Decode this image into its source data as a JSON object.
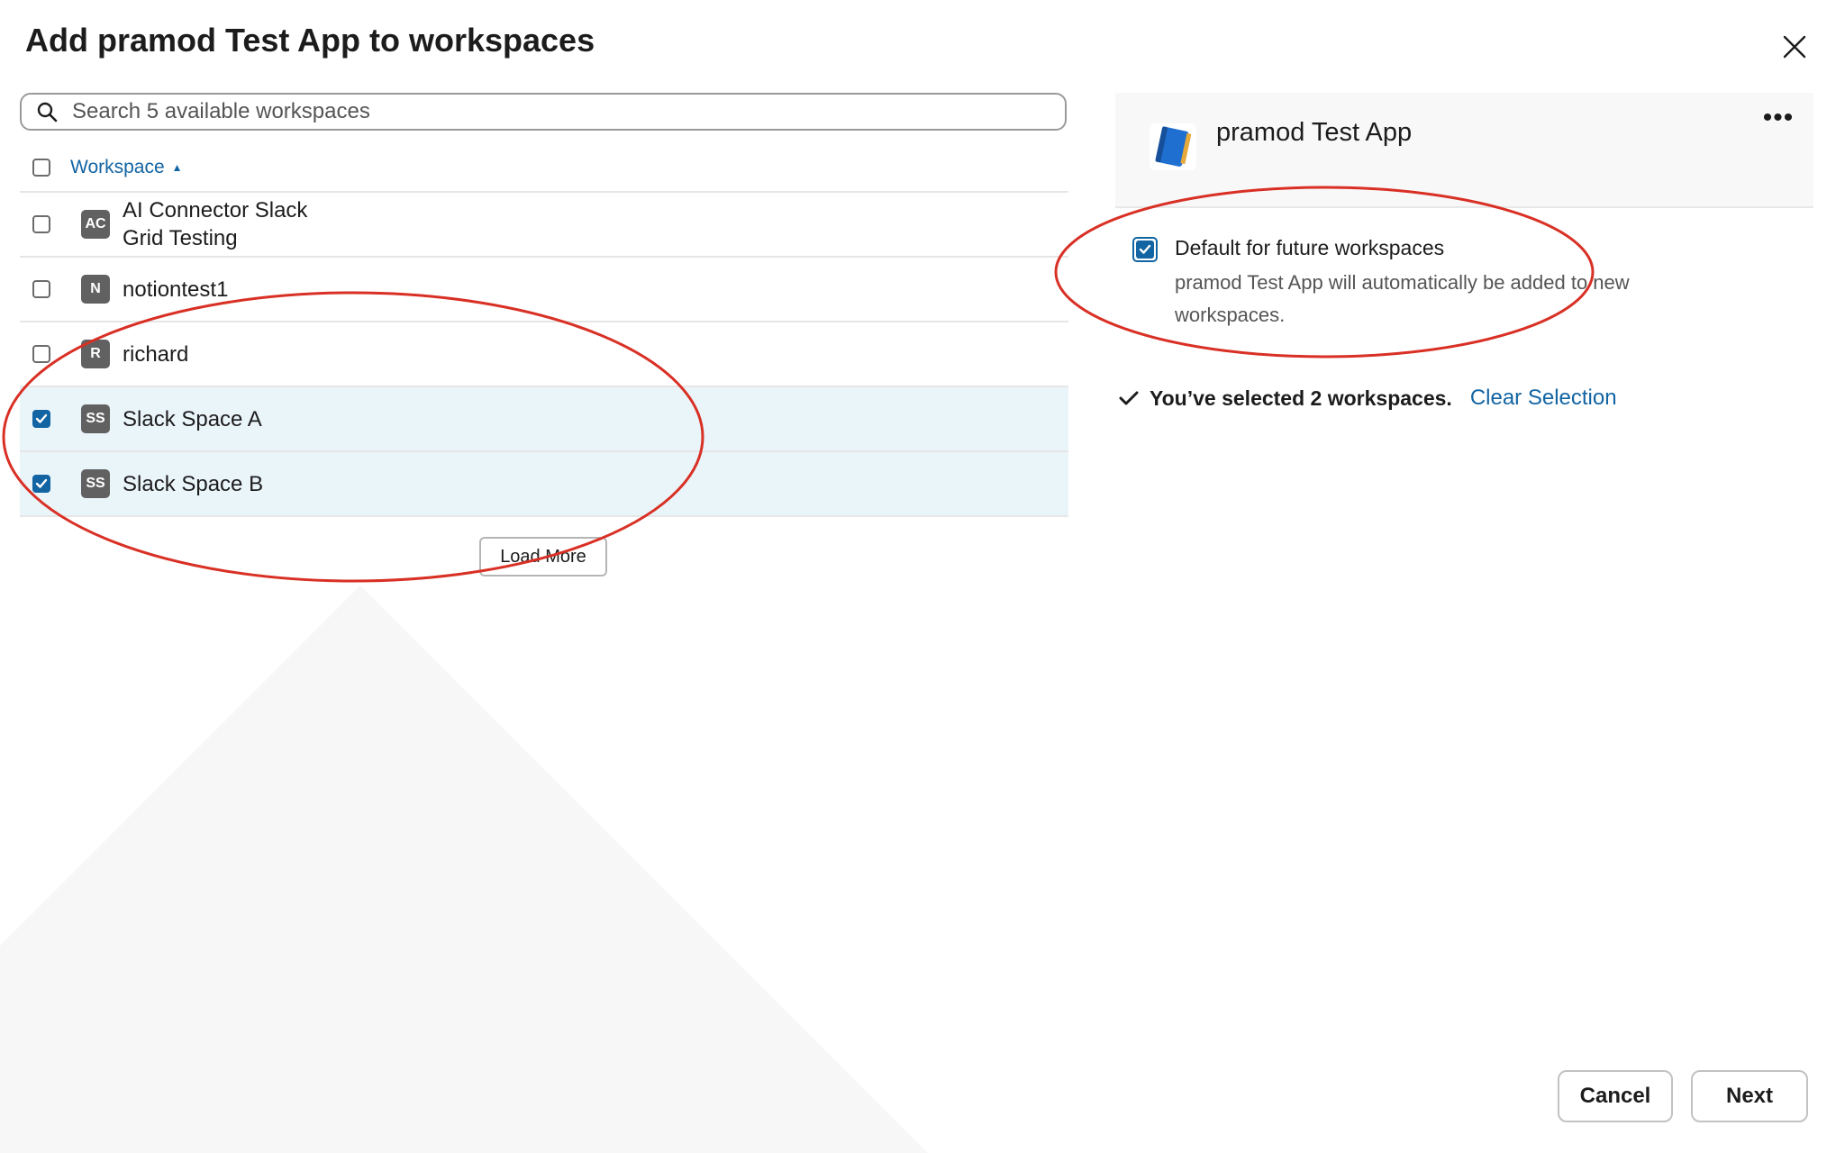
{
  "dialog": {
    "title": "Add pramod Test App to workspaces"
  },
  "search": {
    "placeholder": "Search 5 available workspaces"
  },
  "table": {
    "header_label": "Workspace",
    "rows": [
      {
        "initials": "AC",
        "name": "AI Connector Slack Grid Testing",
        "checked": false
      },
      {
        "initials": "N",
        "name": "notiontest1",
        "checked": false
      },
      {
        "initials": "R",
        "name": "richard",
        "checked": false
      },
      {
        "initials": "SS",
        "name": "Slack Space A",
        "checked": true
      },
      {
        "initials": "SS",
        "name": "Slack Space B",
        "checked": true
      }
    ]
  },
  "load_more_label": "Load More",
  "app": {
    "name": "pramod Test App",
    "more_label": "•••"
  },
  "default_option": {
    "title": "Default for future workspaces",
    "description": "pramod Test App will automatically be added to new workspaces.",
    "checked": true
  },
  "selection": {
    "text": "You’ve selected 2 workspaces.",
    "clear_label": "Clear Selection"
  },
  "footer": {
    "cancel_label": "Cancel",
    "next_label": "Next"
  },
  "colors": {
    "accent": "#1264a3",
    "selected_row": "#eaf5fa",
    "annotation": "#d93025"
  }
}
